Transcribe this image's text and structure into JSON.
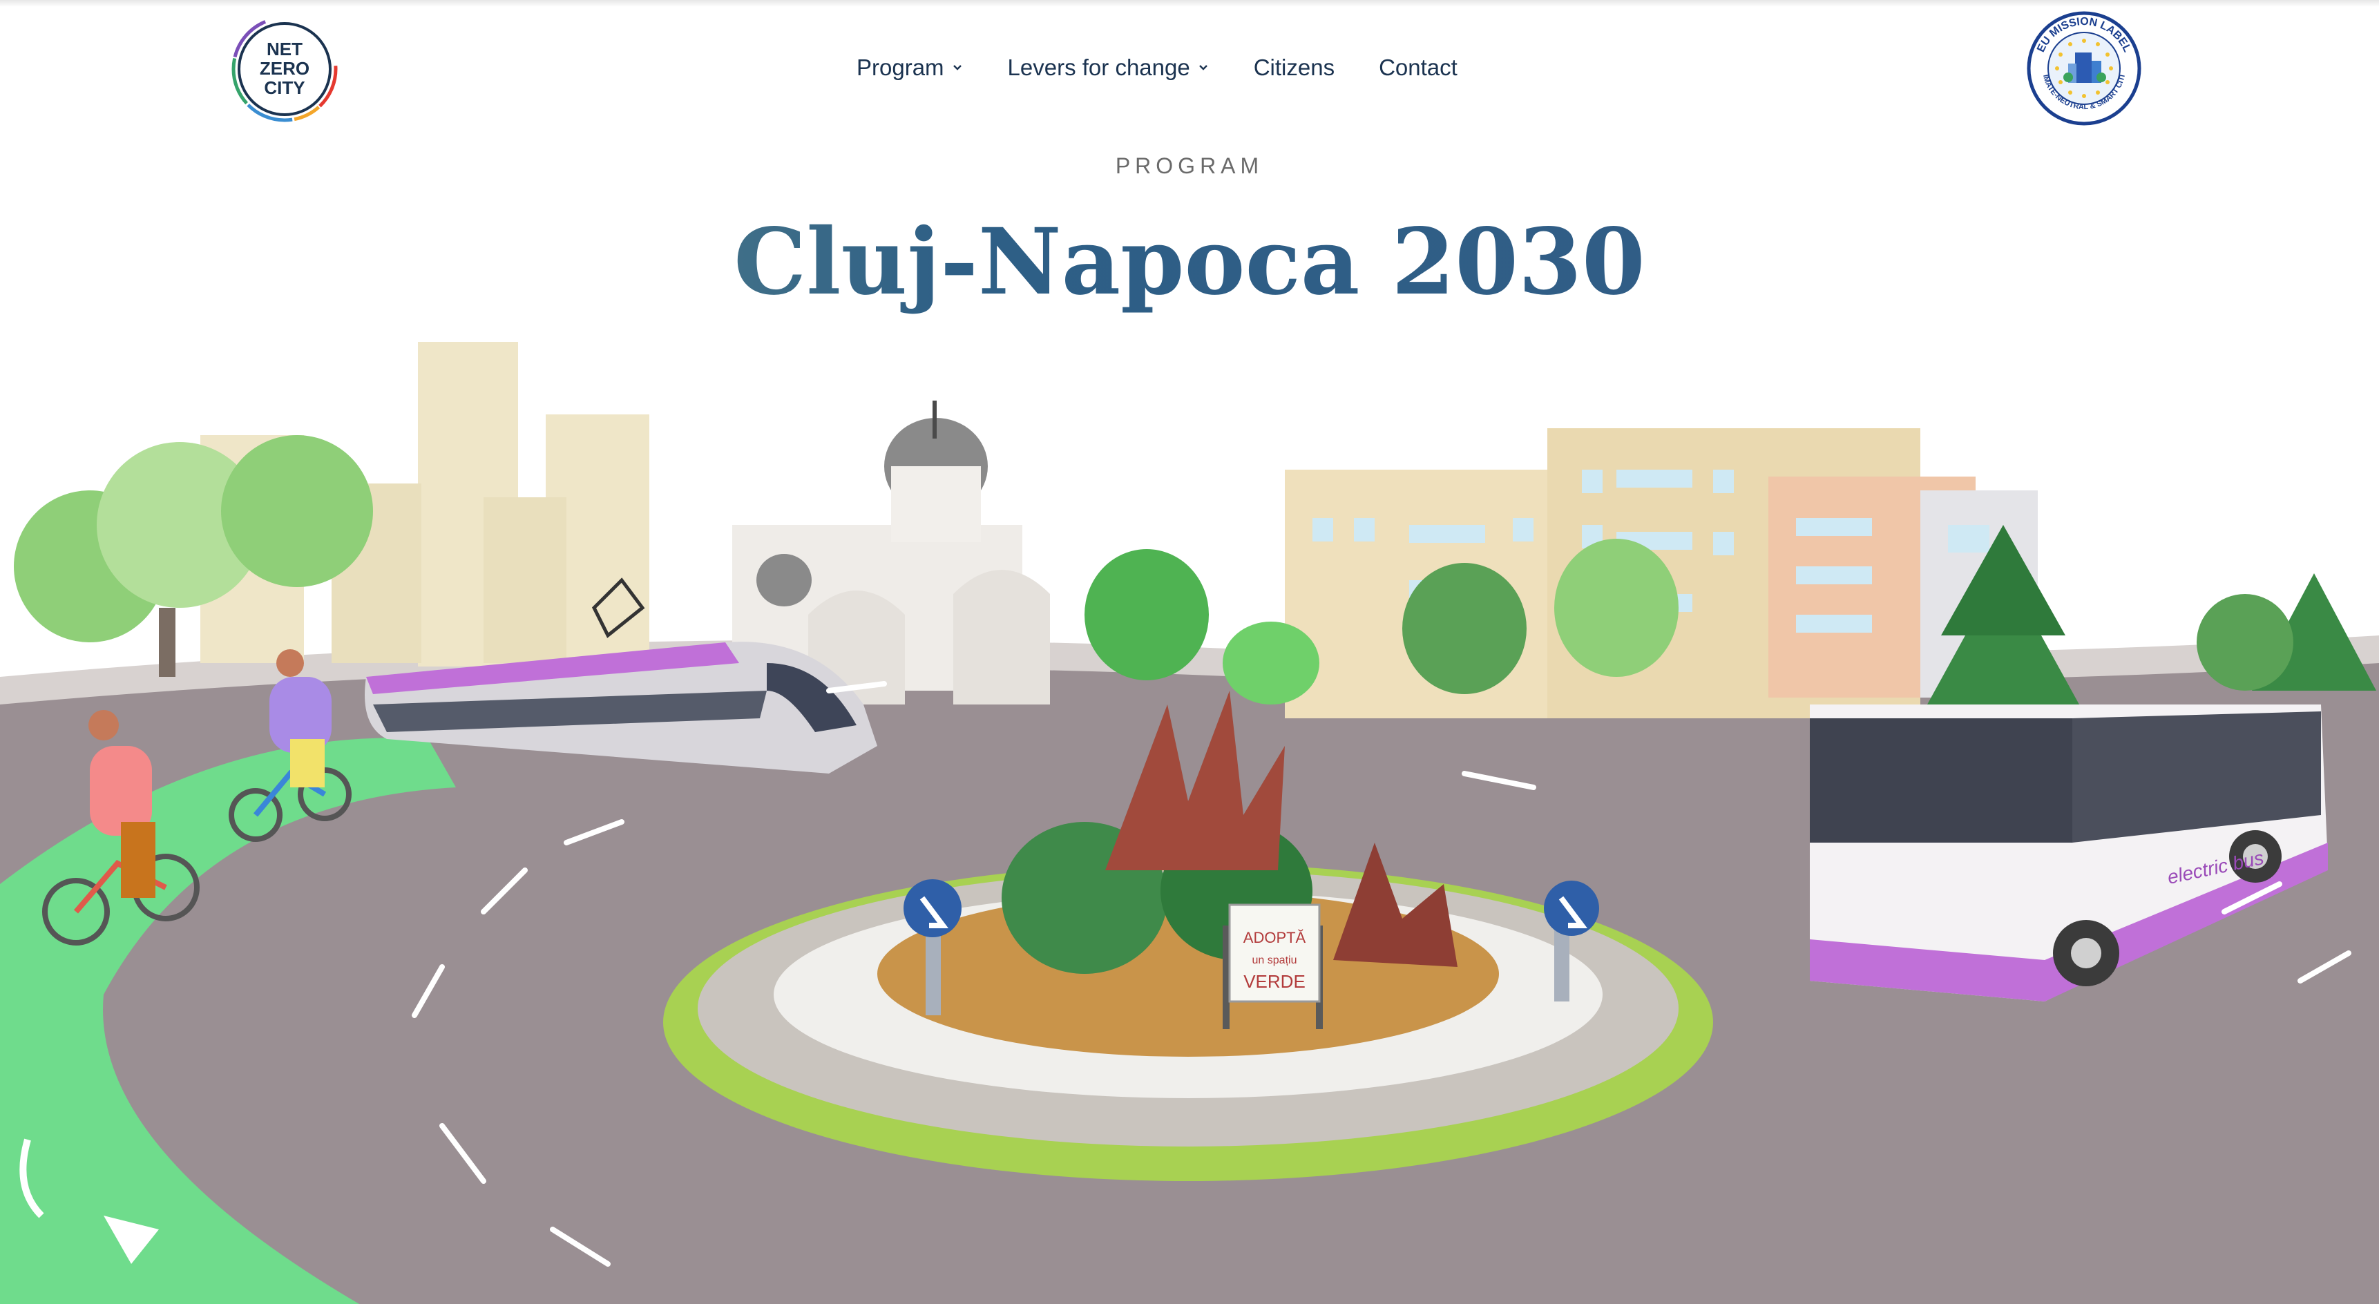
{
  "header": {
    "logo_left": {
      "lines": [
        "NET",
        "ZERO",
        "CITY"
      ]
    },
    "logo_right": {
      "arc_top": "EU MISSION LABEL",
      "arc_bottom": "CLIMATE-NEUTRAL & SMART CITIES"
    },
    "nav": [
      {
        "label": "Program",
        "has_dropdown": true
      },
      {
        "label": "Levers for change",
        "has_dropdown": true
      },
      {
        "label": "Citizens",
        "has_dropdown": false
      },
      {
        "label": "Contact",
        "has_dropdown": false
      }
    ]
  },
  "hero": {
    "eyebrow": "PROGRAM",
    "title": "Cluj-Napoca 2030"
  },
  "illustration": {
    "sign": {
      "line1": "ADOPTĂ",
      "line2": "un spațiu",
      "line3": "VERDE"
    },
    "bus_text": "electric bus",
    "colors": {
      "road": "#9a8f93",
      "bike_lane": "#6fdc8c",
      "sky": "#ffffff",
      "tram_accent": "#c070d8",
      "tree_light": "#8fcf78",
      "tree_dark": "#3f8a4a",
      "building_light": "#efe6c8"
    }
  }
}
